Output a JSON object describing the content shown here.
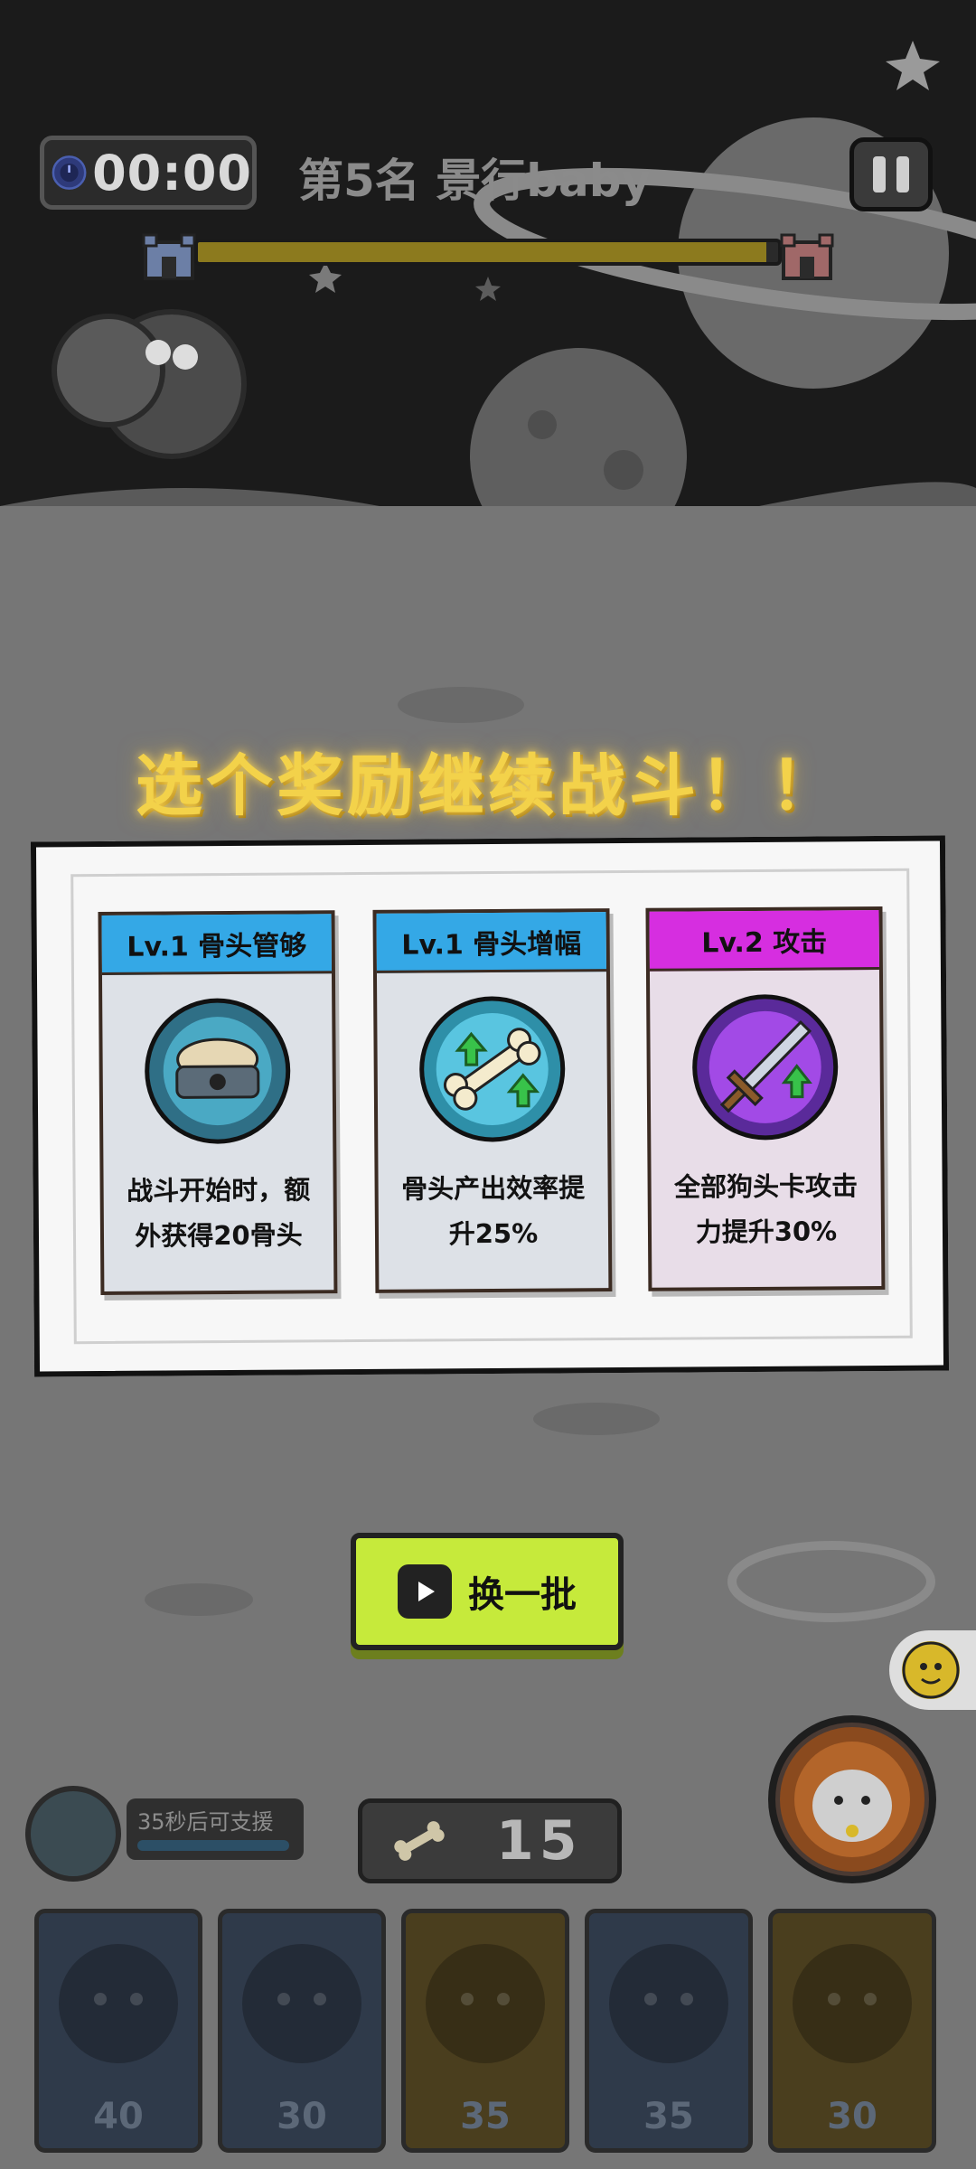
{
  "hud": {
    "timer": "00:00",
    "rank_title": "第5名 景行baby",
    "progress": 0.98
  },
  "headline": "选个奖励继续战斗！！",
  "cards": [
    {
      "level_title": "Lv.1 骨头管够",
      "desc_line1": "战斗开始时，额",
      "desc_line2": "外获得20骨头",
      "color": "#34a8e6",
      "icon": "food-bowl-icon"
    },
    {
      "level_title": "Lv.1 骨头增幅",
      "desc_line1": "骨头产出效率提",
      "desc_line2": "升25%",
      "color": "#34a8e6",
      "icon": "bone-boost-icon"
    },
    {
      "level_title": "Lv.2 攻击",
      "desc_line1": "全部狗头卡攻击",
      "desc_line2": "力提升30%",
      "color": "#d62ee0",
      "icon": "sword-upgrade-icon"
    }
  ],
  "refresh_button": "换一批",
  "support": {
    "text": "35秒后可支援"
  },
  "bones": {
    "count": "15"
  },
  "dock": [
    {
      "cost": "40",
      "color": "#2f3a4a"
    },
    {
      "cost": "30",
      "color": "#2f3a4a"
    },
    {
      "cost": "35",
      "color": "#4a3e1e"
    },
    {
      "cost": "35",
      "color": "#2f3a4a"
    },
    {
      "cost": "30",
      "color": "#4a3e1e"
    }
  ]
}
